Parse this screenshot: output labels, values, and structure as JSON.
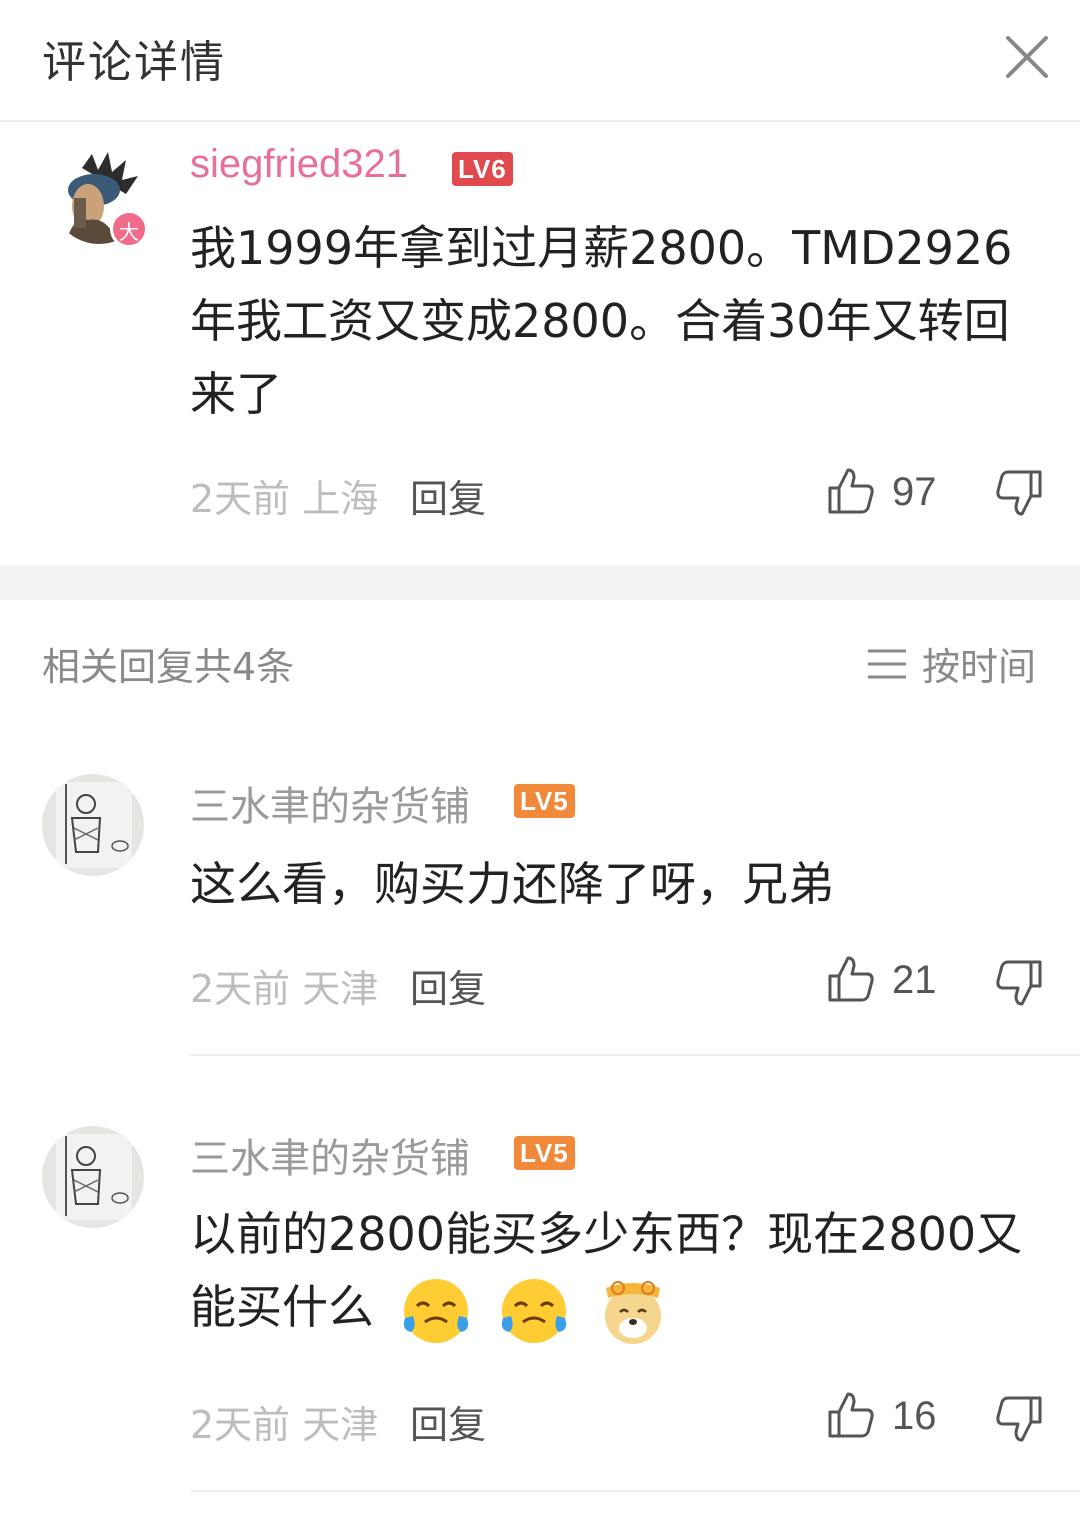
{
  "header": {
    "title": "评论详情"
  },
  "main_comment": {
    "username": "siegfried321",
    "level": "LV6",
    "avatar_badge": "大",
    "text": "我1999年拿到过月薪2800。TMD2926年我工资又变成2800。合着30年又转回来了",
    "time": "2天前",
    "location": "上海",
    "reply_label": "回复",
    "likes": "97"
  },
  "replies_header": {
    "label": "相关回复共4条",
    "sort_label": "按时间"
  },
  "replies": [
    {
      "username": "三水聿的杂货铺",
      "level": "LV5",
      "text": "这么看，购买力还降了呀，兄弟",
      "time": "2天前",
      "location": "天津",
      "reply_label": "回复",
      "likes": "21"
    },
    {
      "username": "三水聿的杂货铺",
      "level": "LV5",
      "text": "以前的2800能买多少东西？现在2800又能买什么",
      "emojis": [
        "crying-laughing-emoji",
        "crying-laughing-emoji",
        "doge-emoji"
      ],
      "time": "2天前",
      "location": "天津",
      "reply_label": "回复",
      "likes": "16"
    }
  ],
  "colors": {
    "username_main": "#e86f9a",
    "lv6": "#e0494d",
    "lv5": "#f08a3a"
  }
}
